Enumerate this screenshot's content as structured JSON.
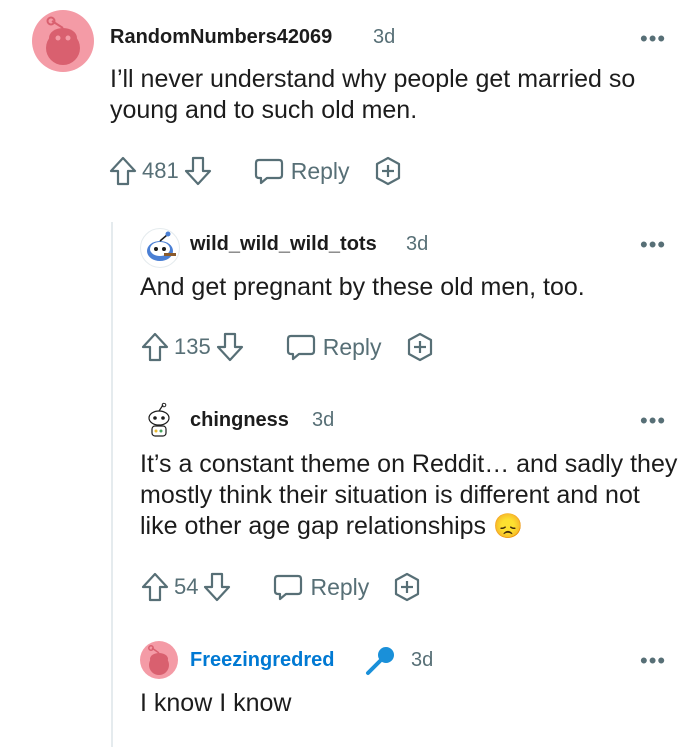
{
  "comments": [
    {
      "username": "RandomNumbers42069",
      "time": "3d",
      "text": "I’ll never understand why people get married so young and to such old men.",
      "score": "481",
      "reply_label": "Reply"
    },
    {
      "username": "wild_wild_wild_tots",
      "time": "3d",
      "text": "And get pregnant by these old men, too.",
      "score": "135",
      "reply_label": "Reply"
    },
    {
      "username": "chingness",
      "time": "3d",
      "text": "It’s a constant theme on Reddit… and sadly they mostly think their situation is different and not like other age gap relationships",
      "emoji": "😞",
      "score": "54",
      "reply_label": "Reply"
    },
    {
      "username": "Freezingredred",
      "time": "3d",
      "text": "I know I know",
      "flair_icon": "microphone-icon"
    }
  ],
  "colors": {
    "text": "#1c1c1c",
    "muted": "#576f76",
    "flair_blue": "#0079d3",
    "avatar_pink": "#f49ba6",
    "thread_line": "#e5ebee"
  }
}
